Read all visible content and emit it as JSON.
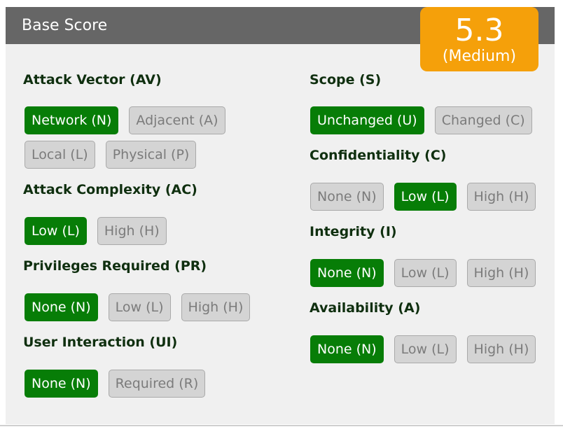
{
  "header": {
    "title": "Base Score"
  },
  "score": {
    "value": "5.3",
    "severity": "(Medium)",
    "color": "#f5a00a"
  },
  "colors": {
    "selected": "#077d07",
    "unselected": "#d4d4d4",
    "header": "#666666"
  },
  "metrics": {
    "av": {
      "title": "Attack Vector (AV)",
      "options": [
        "Network (N)",
        "Adjacent (A)",
        "Local (L)",
        "Physical (P)"
      ],
      "selected": "Network (N)"
    },
    "ac": {
      "title": "Attack Complexity (AC)",
      "options": [
        "Low (L)",
        "High (H)"
      ],
      "selected": "Low (L)"
    },
    "pr": {
      "title": "Privileges Required (PR)",
      "options": [
        "None (N)",
        "Low (L)",
        "High (H)"
      ],
      "selected": "None (N)"
    },
    "ui": {
      "title": "User Interaction (UI)",
      "options": [
        "None (N)",
        "Required (R)"
      ],
      "selected": "None (N)"
    },
    "s": {
      "title": "Scope (S)",
      "options": [
        "Unchanged (U)",
        "Changed (C)"
      ],
      "selected": "Unchanged (U)"
    },
    "c": {
      "title": "Confidentiality (C)",
      "options": [
        "None (N)",
        "Low (L)",
        "High (H)"
      ],
      "selected": "Low (L)"
    },
    "i": {
      "title": "Integrity (I)",
      "options": [
        "None (N)",
        "Low (L)",
        "High (H)"
      ],
      "selected": "None (N)"
    },
    "a": {
      "title": "Availability (A)",
      "options": [
        "None (N)",
        "Low (L)",
        "High (H)"
      ],
      "selected": "None (N)"
    }
  }
}
